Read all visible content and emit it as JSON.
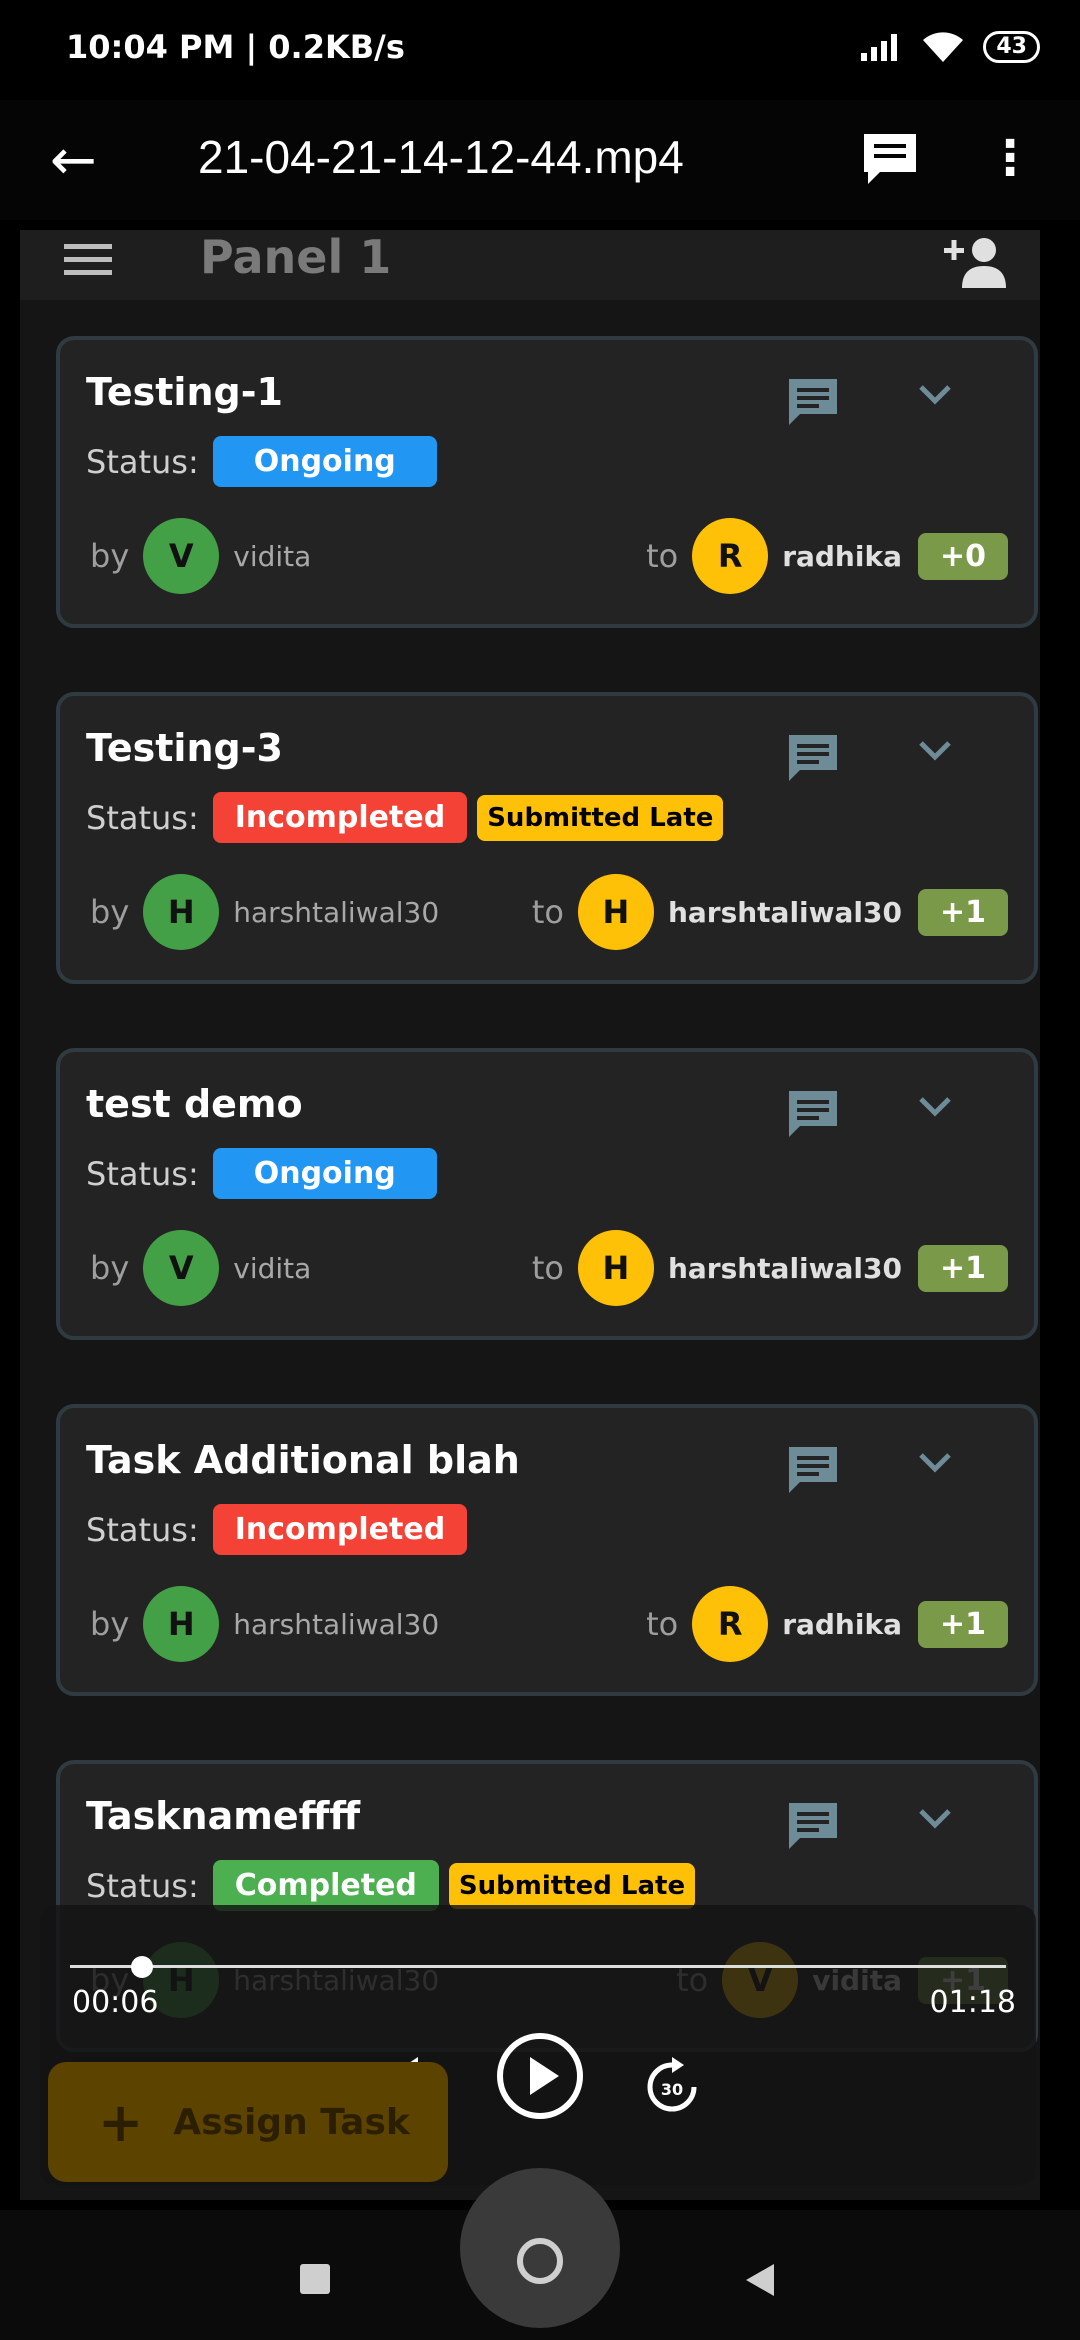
{
  "status_bar": {
    "time_speed": "10:04 PM | 0.2KB/s",
    "battery": "43"
  },
  "player": {
    "title": "21-04-21-14-12-44.mp4",
    "current_time": "00:06",
    "total_time": "01:18",
    "progress": 0.077,
    "rewind_seconds": "30",
    "forward_seconds": "30"
  },
  "app": {
    "panel_title": "Panel 1",
    "fab_label": "Assign Task",
    "status_label": "Status:",
    "by_label": "by",
    "to_label": "to"
  },
  "tasks": [
    {
      "title": "Testing-1",
      "badges": [
        {
          "text": "Ongoing",
          "kind": "ongoing"
        }
      ],
      "by_initial": "V",
      "by_name": "vidita",
      "to_initial": "R",
      "to_name": "radhika",
      "extra": "+0"
    },
    {
      "title": "Testing-3",
      "badges": [
        {
          "text": "Incompleted",
          "kind": "incomp"
        },
        {
          "text": "Submitted Late",
          "kind": "late"
        }
      ],
      "by_initial": "H",
      "by_name": "harshtaliwal30",
      "to_initial": "H",
      "to_name": "harshtaliwal30",
      "extra": "+1"
    },
    {
      "title": "test demo",
      "badges": [
        {
          "text": "Ongoing",
          "kind": "ongoing"
        }
      ],
      "by_initial": "V",
      "by_name": "vidita",
      "to_initial": "H",
      "to_name": "harshtaliwal30",
      "extra": "+1"
    },
    {
      "title": "Task Additional blah",
      "badges": [
        {
          "text": "Incompleted",
          "kind": "incomp"
        }
      ],
      "by_initial": "H",
      "by_name": "harshtaliwal30",
      "to_initial": "R",
      "to_name": "radhika",
      "extra": "+1"
    },
    {
      "title": "Tasknameffff",
      "badges": [
        {
          "text": "Completed",
          "kind": "complete"
        },
        {
          "text": "Submitted Late",
          "kind": "late"
        }
      ],
      "by_initial": "H",
      "by_name": "harshtaliwal30",
      "to_initial": "V",
      "to_name": "vidita",
      "extra": "+1"
    }
  ]
}
